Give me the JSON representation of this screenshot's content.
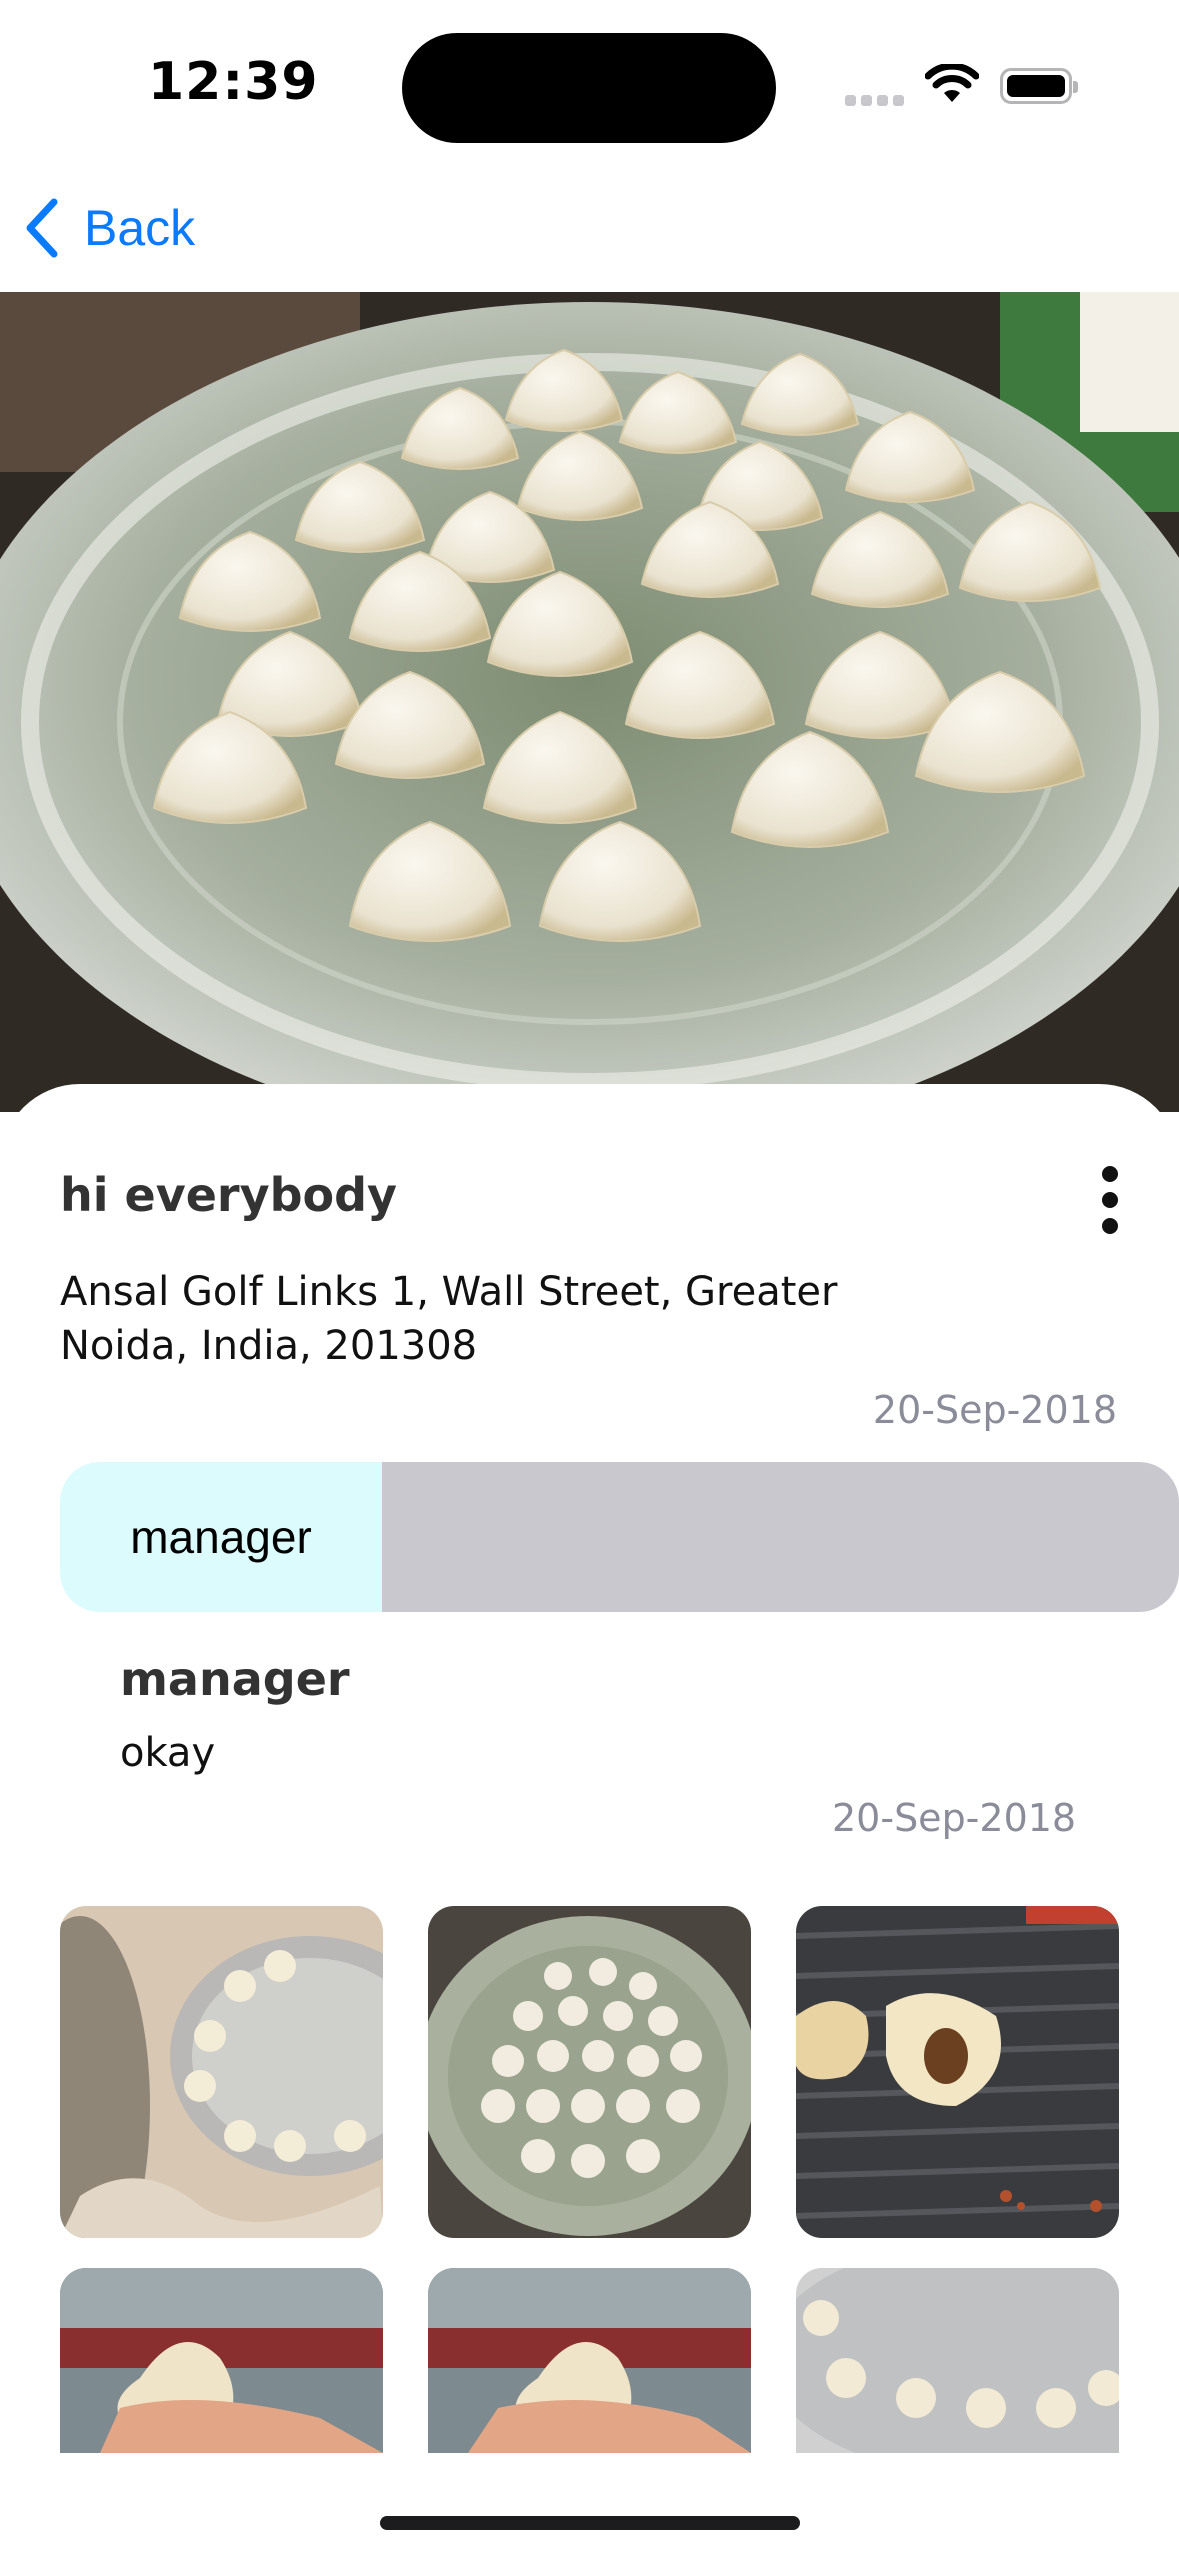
{
  "status_bar": {
    "time": "12:39"
  },
  "nav": {
    "back_label": "Back"
  },
  "post": {
    "title": "hi everybody",
    "address": "Ansal Golf Links 1, Wall Street, Greater Noida, India, 201308",
    "date": "20-Sep-2018"
  },
  "role_tab": {
    "label": "manager"
  },
  "comment": {
    "author": "manager",
    "text": "okay",
    "date": "20-Sep-2018"
  },
  "colors": {
    "accent": "#0a7aff",
    "chip_bg": "#dcfbfd",
    "bar_bg": "#c9c8cf",
    "muted": "#8a8d99"
  },
  "icons": [
    "back-chevron-icon",
    "more-vertical-icon",
    "wifi-icon",
    "battery-icon",
    "signal-icon"
  ]
}
